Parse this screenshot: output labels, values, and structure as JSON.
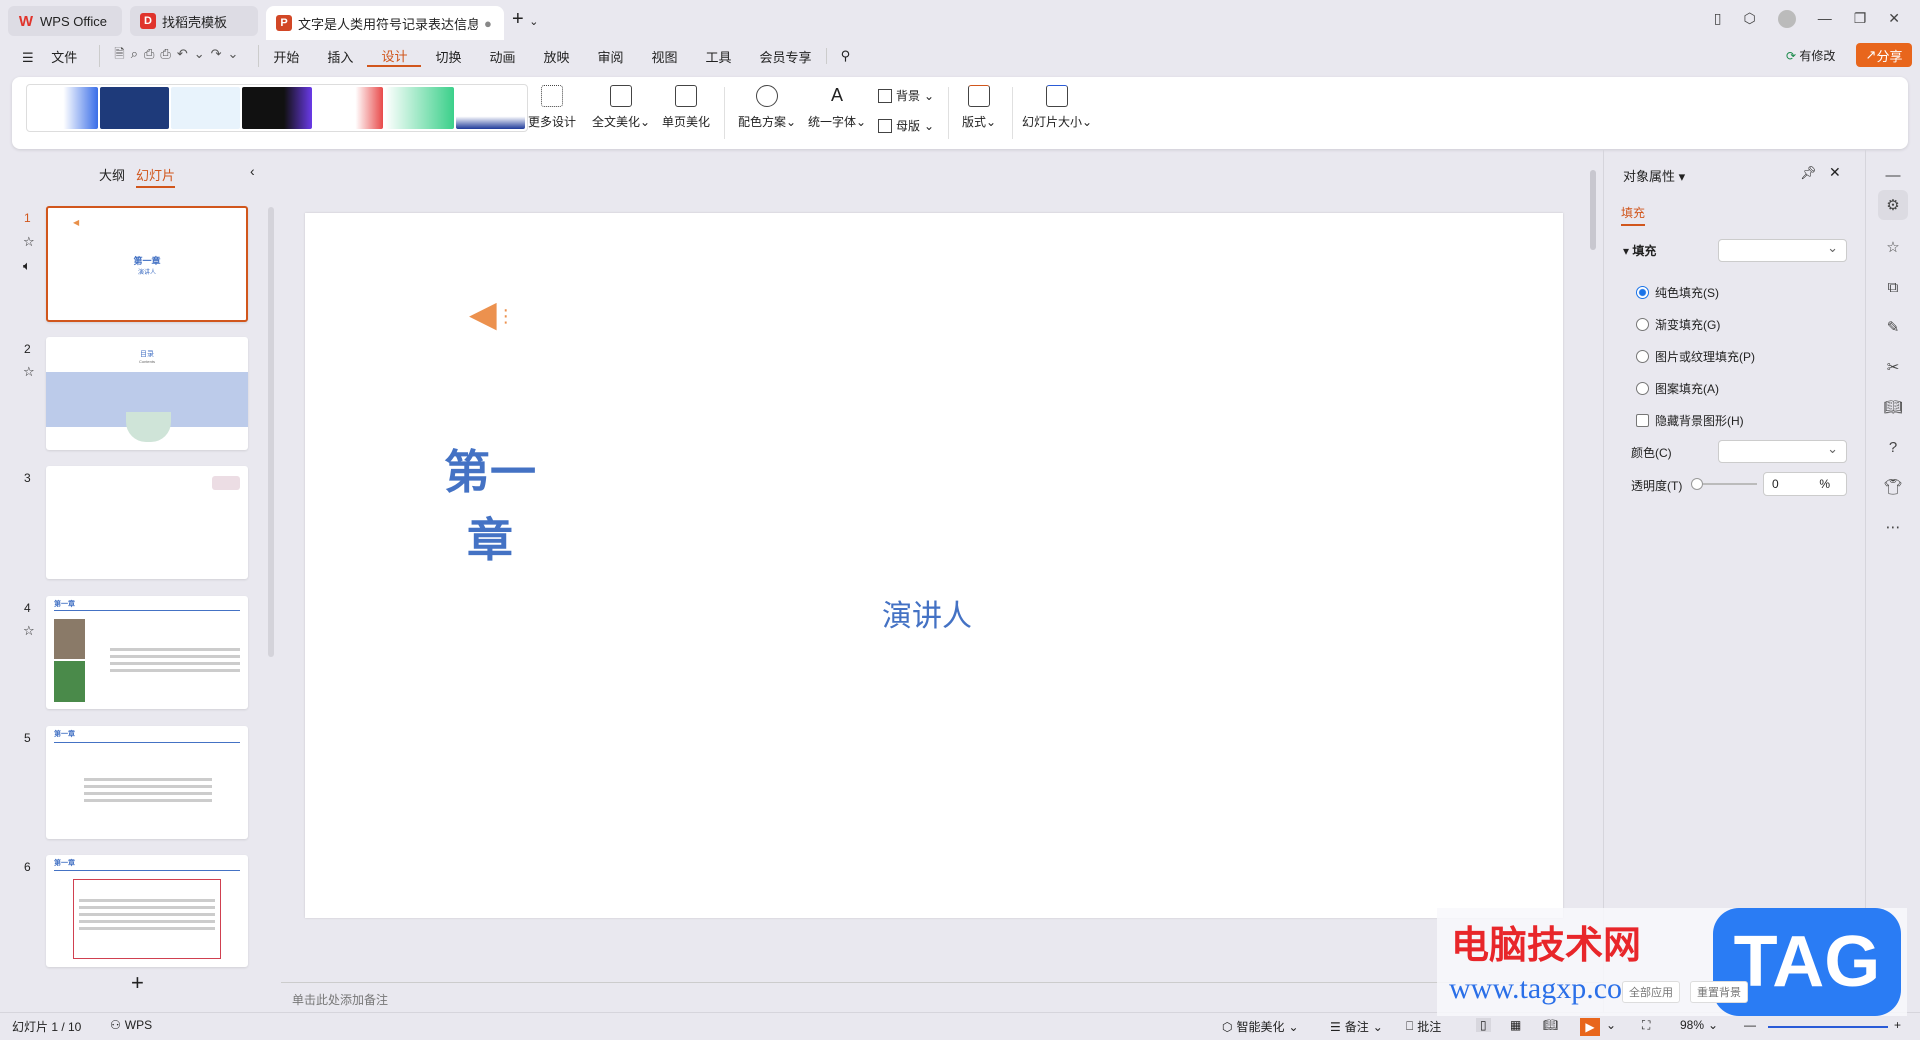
{
  "tabs": [
    {
      "label": "WPS Office",
      "icon": "wps-logo"
    },
    {
      "label": "找稻壳模板",
      "icon": "docer-logo"
    },
    {
      "label": "文字是人类用符号记录表达信息以(",
      "icon": "ppt-logo"
    }
  ],
  "menu": {
    "file": "文件",
    "items": [
      "开始",
      "插入",
      "设计",
      "切换",
      "动画",
      "放映",
      "审阅",
      "视图",
      "工具",
      "会员专享"
    ],
    "active": "设计"
  },
  "header_right": {
    "modified": "有修改",
    "share": "分享"
  },
  "ribbon": {
    "more_design": "更多设计",
    "beautify_all": "全文美化",
    "beautify_page": "单页美化",
    "color_scheme": "配色方案",
    "unify_font": "统一字体",
    "background": "背景",
    "master": "母版",
    "layout": "版式",
    "slide_size": "幻灯片大小"
  },
  "left_panel": {
    "outline_tab": "大纲",
    "slides_tab": "幻灯片",
    "thumbs": [
      {
        "num": "1",
        "title": "第一章",
        "sub": "演讲人"
      },
      {
        "num": "2",
        "title": "目录",
        "sub": "Contents"
      },
      {
        "num": "3"
      },
      {
        "num": "4",
        "title": "第一章"
      },
      {
        "num": "5",
        "title": "第一章"
      },
      {
        "num": "6",
        "title": "第一章"
      }
    ]
  },
  "slide": {
    "title_line1": "第一",
    "title_line2": "章",
    "speaker": "演讲人"
  },
  "notes_placeholder": "单击此处添加备注",
  "props": {
    "title": "对象属性",
    "tab": "填充",
    "section": "填充",
    "options": [
      "纯色填充(S)",
      "渐变填充(G)",
      "图片或纹理填充(P)",
      "图案填充(A)"
    ],
    "selected": 0,
    "hide_bg": "隐藏背景图形(H)",
    "color_label": "颜色(C)",
    "transparency_label": "透明度(T)",
    "transparency_value": "0",
    "percent": "%",
    "apply_all": "全部应用",
    "reset_bg": "重置背景"
  },
  "status": {
    "slide_count": "幻灯片 1 / 10",
    "wps": "WPS",
    "smart": "智能美化",
    "notes": "备注",
    "comment": "批注",
    "zoom": "98%"
  },
  "watermark": {
    "site_cn": "电脑技术网",
    "url": "www.tagxp.com",
    "tag": "TAG"
  },
  "colors": {
    "accent": "#d1561c",
    "title_blue": "#4472c4",
    "share": "#e8661c"
  }
}
